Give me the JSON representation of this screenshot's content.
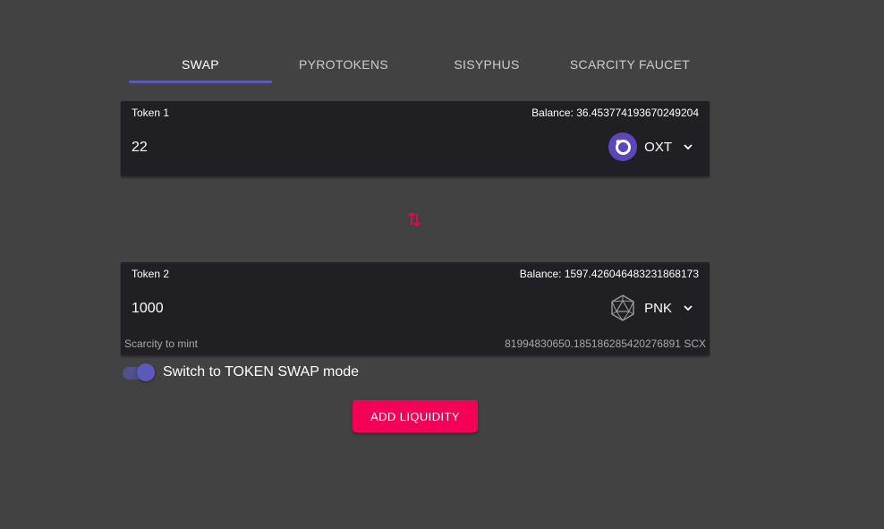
{
  "tabs": [
    {
      "label": "SWAP",
      "active": true
    },
    {
      "label": "PYROTOKENS",
      "active": false
    },
    {
      "label": "SISYPHUS",
      "active": false
    },
    {
      "label": "SCARCITY FAUCET",
      "active": false
    }
  ],
  "token1": {
    "label": "Token 1",
    "balance": "Balance: 36.453774193670249204",
    "amount": "22",
    "symbol": "OXT",
    "logo_icon": "orchid-logo-icon"
  },
  "token2": {
    "label": "Token 2",
    "balance": "Balance: 1597.426046483231868173",
    "amount": "1000",
    "symbol": "PNK",
    "logo_icon": "kleros-logo-icon",
    "scarcity_label": "Scarcity to mint",
    "scarcity_value": "81994830650.185186285420276891 SCX"
  },
  "swap_icon": "swap-vertical-icon",
  "toggle": {
    "label": "Switch to TOKEN SWAP mode",
    "checked": true
  },
  "add_button": {
    "label": "ADD LIQUIDITY"
  },
  "colors": {
    "background": "#424242",
    "card": "#202024",
    "primary": "#5c5ab8",
    "accent": "#f50057"
  }
}
